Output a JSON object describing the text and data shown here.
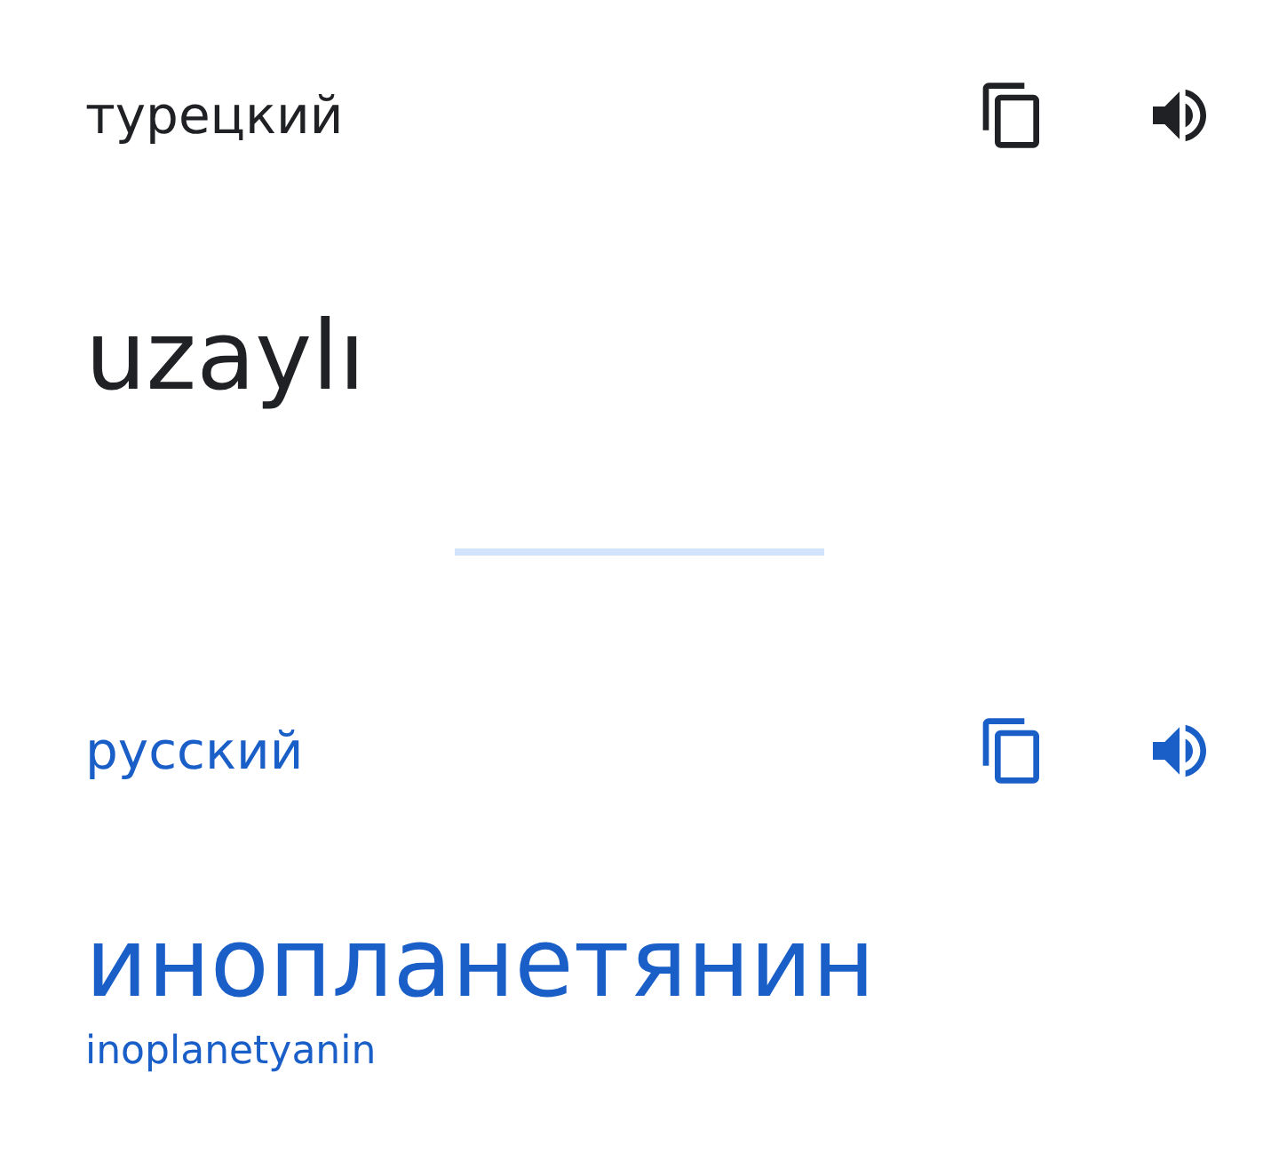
{
  "source": {
    "language": "турецкий",
    "text": "uzaylı"
  },
  "target": {
    "language": "русский",
    "text": "инопланетянин",
    "transliteration": "inoplanetyanin"
  }
}
